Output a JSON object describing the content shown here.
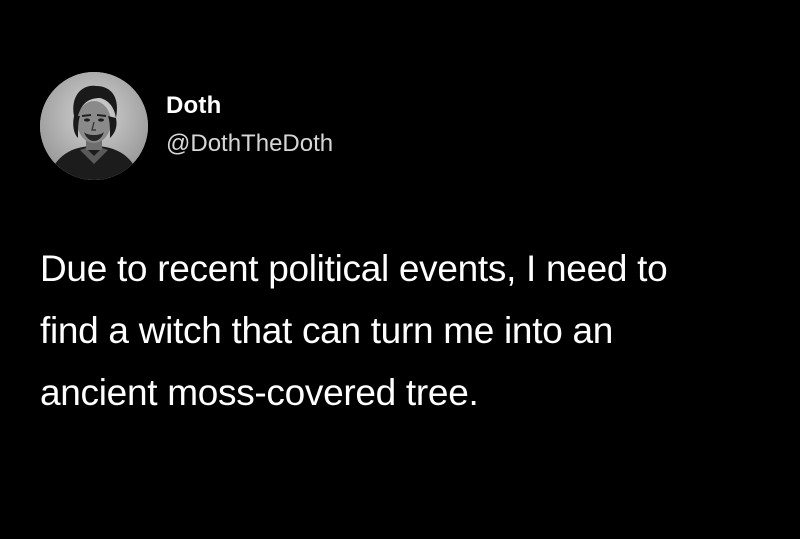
{
  "tweet": {
    "author": {
      "display_name": "Doth",
      "handle": "@DothTheDoth",
      "avatar_icon": "portrait-avatar"
    },
    "text_lines": [
      "Due to recent political events, I need to",
      "find a witch that can turn me into an",
      "ancient moss-covered tree."
    ]
  },
  "colors": {
    "background": "#000000",
    "text": "#ffffff",
    "handle": "#d7d7d7"
  }
}
